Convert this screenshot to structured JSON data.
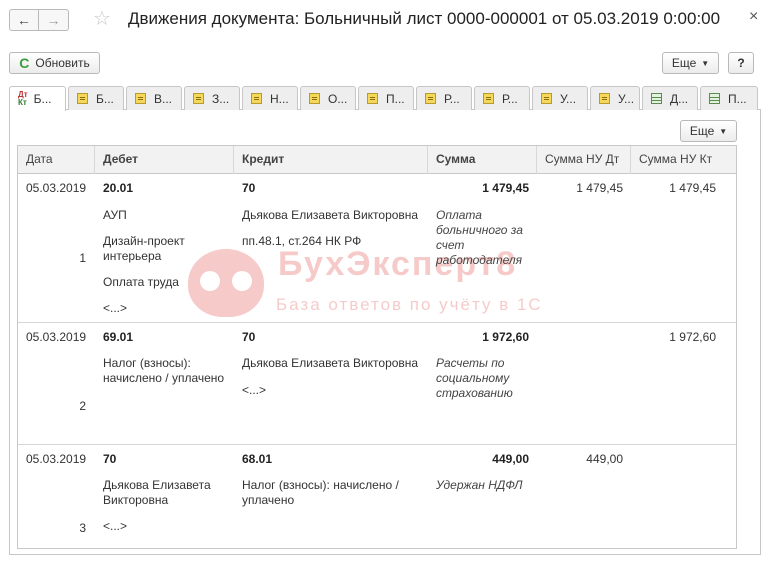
{
  "window": {
    "title": "Движения документа: Больничный лист 0000-000001 от 05.03.2019 0:00:00",
    "back_glyph": "←",
    "forward_glyph": "→",
    "star_glyph": "☆",
    "close_glyph": "×"
  },
  "toolbar": {
    "refresh_label": "Обновить",
    "refresh_glyph": "C",
    "more_label": "Еще",
    "help_label": "?"
  },
  "tabs": [
    {
      "label": "Б...",
      "icon": "accounting-register-icon",
      "active": true
    },
    {
      "label": "Б...",
      "icon": "register-icon"
    },
    {
      "label": "В...",
      "icon": "register-icon"
    },
    {
      "label": "З...",
      "icon": "register-icon"
    },
    {
      "label": "Н...",
      "icon": "register-icon"
    },
    {
      "label": "О...",
      "icon": "register-icon"
    },
    {
      "label": "П...",
      "icon": "register-icon"
    },
    {
      "label": "Р...",
      "icon": "register-icon"
    },
    {
      "label": "Р...",
      "icon": "register-icon"
    },
    {
      "label": "У...",
      "icon": "register-icon"
    },
    {
      "label": "У...",
      "icon": "register-icon"
    },
    {
      "label": "Д...",
      "icon": "table-icon"
    },
    {
      "label": "П...",
      "icon": "table-icon"
    }
  ],
  "tab_icon_text": {
    "top": "Дт",
    "bottom": "Кт"
  },
  "panel": {
    "more_label": "Еще"
  },
  "table": {
    "columns": [
      "Дата",
      "Дебет",
      "Кредит",
      "Сумма",
      "Сумма НУ Дт",
      "Сумма НУ Кт"
    ],
    "rows": [
      {
        "date": "05.03.2019",
        "num": "1",
        "debit_account": "20.01",
        "debit_sub": [
          "АУП",
          "Дизайн-проект интерьера",
          "Оплата труда",
          "<...>"
        ],
        "credit_account": "70",
        "credit_sub": [
          "Дьякова Елизавета Викторовна",
          "пп.48.1, ст.264 НК РФ"
        ],
        "sum": "1 479,45",
        "content": "Оплата больничного за счет работодателя",
        "sum_nu_dt": "1 479,45",
        "sum_nu_kt": "1 479,45"
      },
      {
        "date": "05.03.2019",
        "num": "2",
        "debit_account": "69.01",
        "debit_sub": [
          "Налог (взносы): начислено / уплачено"
        ],
        "credit_account": "70",
        "credit_sub": [
          "Дьякова Елизавета Викторовна",
          "<...>"
        ],
        "sum": "1 972,60",
        "content": "Расчеты по социальному страхованию",
        "sum_nu_dt": "",
        "sum_nu_kt": "1 972,60"
      },
      {
        "date": "05.03.2019",
        "num": "3",
        "debit_account": "70",
        "debit_sub": [
          "Дьякова Елизавета Викторовна",
          "<...>"
        ],
        "credit_account": "68.01",
        "credit_sub": [
          "Налог (взносы): начислено / уплачено"
        ],
        "sum": "449,00",
        "content": "Удержан НДФЛ",
        "sum_nu_dt": "449,00",
        "sum_nu_kt": ""
      }
    ]
  },
  "watermark": {
    "title": "БухЭксперт8",
    "subtitle": "База ответов по учёту в 1С"
  }
}
